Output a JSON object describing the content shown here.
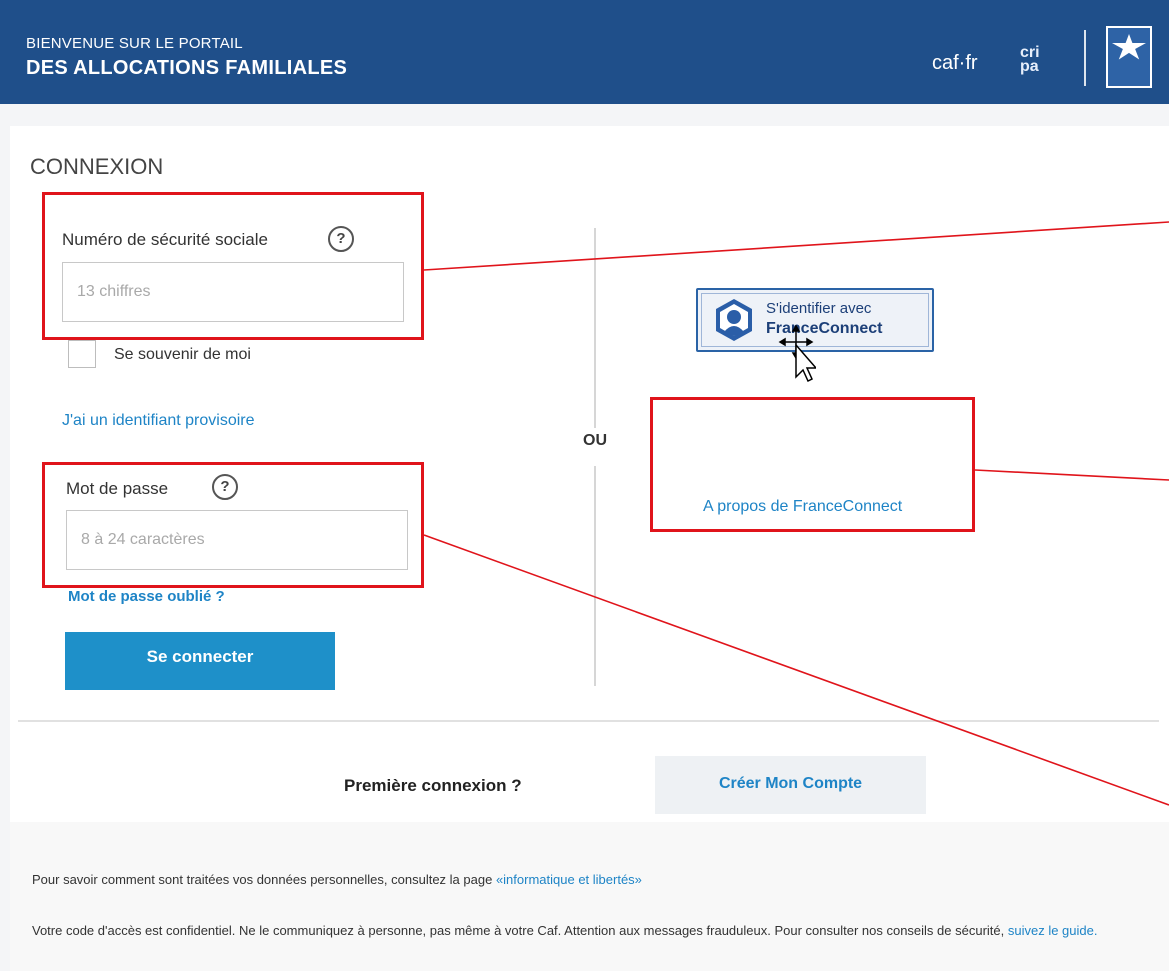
{
  "header": {
    "line1": "BIENVENUE SUR LE PORTAIL",
    "line2": "DES ALLOCATIONS FAMILIALES",
    "brand1": "caf·fr",
    "brand2_top": "cri",
    "brand2_bottom": "pa"
  },
  "login": {
    "title": "CONNEXION",
    "ssn_label": "Numéro de sécurité sociale",
    "ssn_placeholder": "13 chiffres",
    "help_glyph": "?",
    "remember_label": "Se souvenir de moi",
    "provisional_link": "J'ai un identifiant provisoire",
    "password_label": "Mot de passe",
    "password_placeholder": "8 à 24 caractères",
    "forgot_link": "Mot de passe oublié ?",
    "submit": "Se connecter",
    "or": "OU"
  },
  "franceconnect": {
    "line1": "S'identifier avec",
    "line2": "FranceConnect",
    "about": "A propos de FranceConnect"
  },
  "signup": {
    "question": "Première connexion ?",
    "button": "Créer Mon Compte"
  },
  "footer": {
    "privacy_text": "Pour savoir comment sont traitées vos données personnelles, consultez la page ",
    "privacy_link": "«informatique et libertés»",
    "security_text": "Votre code d'accès est confidentiel. Ne le communiquez à personne, pas même à votre Caf. Attention aux messages frauduleux. Pour consulter nos conseils de sécurité, ",
    "security_link": "suivez le guide."
  },
  "colors": {
    "header_bg": "#1f4f8a",
    "primary_button": "#1e90c9",
    "link": "#1e84c6",
    "annotation": "#e0141b"
  }
}
